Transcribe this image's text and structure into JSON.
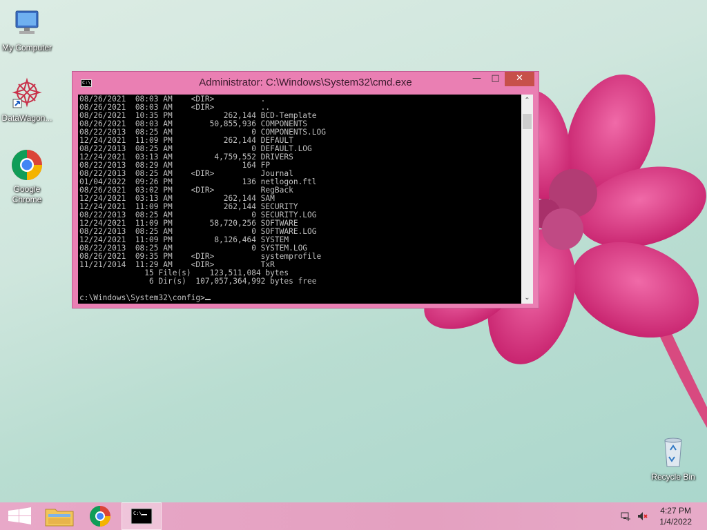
{
  "desktop": {
    "icons": [
      {
        "label": "My Computer"
      },
      {
        "label": "DataWagon..."
      },
      {
        "label": "Google Chrome"
      },
      {
        "label": "Recycle Bin"
      }
    ]
  },
  "window": {
    "title": "Administrator: C:\\Windows\\System32\\cmd.exe",
    "icon_text": "C:\\",
    "min_glyph": "—",
    "max_glyph": "□",
    "close_glyph": "✕",
    "console_lines": [
      "08/26/2021  08:03 AM    <DIR>          .",
      "08/26/2021  08:03 AM    <DIR>          ..",
      "08/26/2021  10:35 PM           262,144 BCD-Template",
      "08/26/2021  08:03 AM        50,855,936 COMPONENTS",
      "08/22/2013  08:25 AM                 0 COMPONENTS.LOG",
      "12/24/2021  11:09 PM           262,144 DEFAULT",
      "08/22/2013  08:25 AM                 0 DEFAULT.LOG",
      "12/24/2021  03:13 AM         4,759,552 DRIVERS",
      "08/22/2013  08:29 AM               164 FP",
      "08/22/2013  08:25 AM    <DIR>          Journal",
      "01/04/2022  09:26 PM               136 netlogon.ftl",
      "08/26/2021  03:02 PM    <DIR>          RegBack",
      "12/24/2021  03:13 AM           262,144 SAM",
      "12/24/2021  11:09 PM           262,144 SECURITY",
      "08/22/2013  08:25 AM                 0 SECURITY.LOG",
      "12/24/2021  11:09 PM        58,720,256 SOFTWARE",
      "08/22/2013  08:25 AM                 0 SOFTWARE.LOG",
      "12/24/2021  11:09 PM         8,126,464 SYSTEM",
      "08/22/2013  08:25 AM                 0 SYSTEM.LOG",
      "08/26/2021  09:35 PM    <DIR>          systemprofile",
      "11/21/2014  11:29 AM    <DIR>          TxR",
      "              15 File(s)    123,511,084 bytes",
      "               6 Dir(s)  107,057,364,992 bytes free",
      "",
      "c:\\Windows\\System32\\config>"
    ]
  },
  "taskbar": {
    "clock_time": "4:27 PM",
    "clock_date": "1/4/2022",
    "items": [
      "start-button",
      "file-explorer",
      "google-chrome",
      "command-prompt"
    ]
  },
  "colors": {
    "window_frame": "#ea7fb3",
    "close_button": "#c7504a",
    "console_bg": "#000000",
    "console_fg": "#c0c0c0",
    "taskbar": "#e4a0c0"
  }
}
